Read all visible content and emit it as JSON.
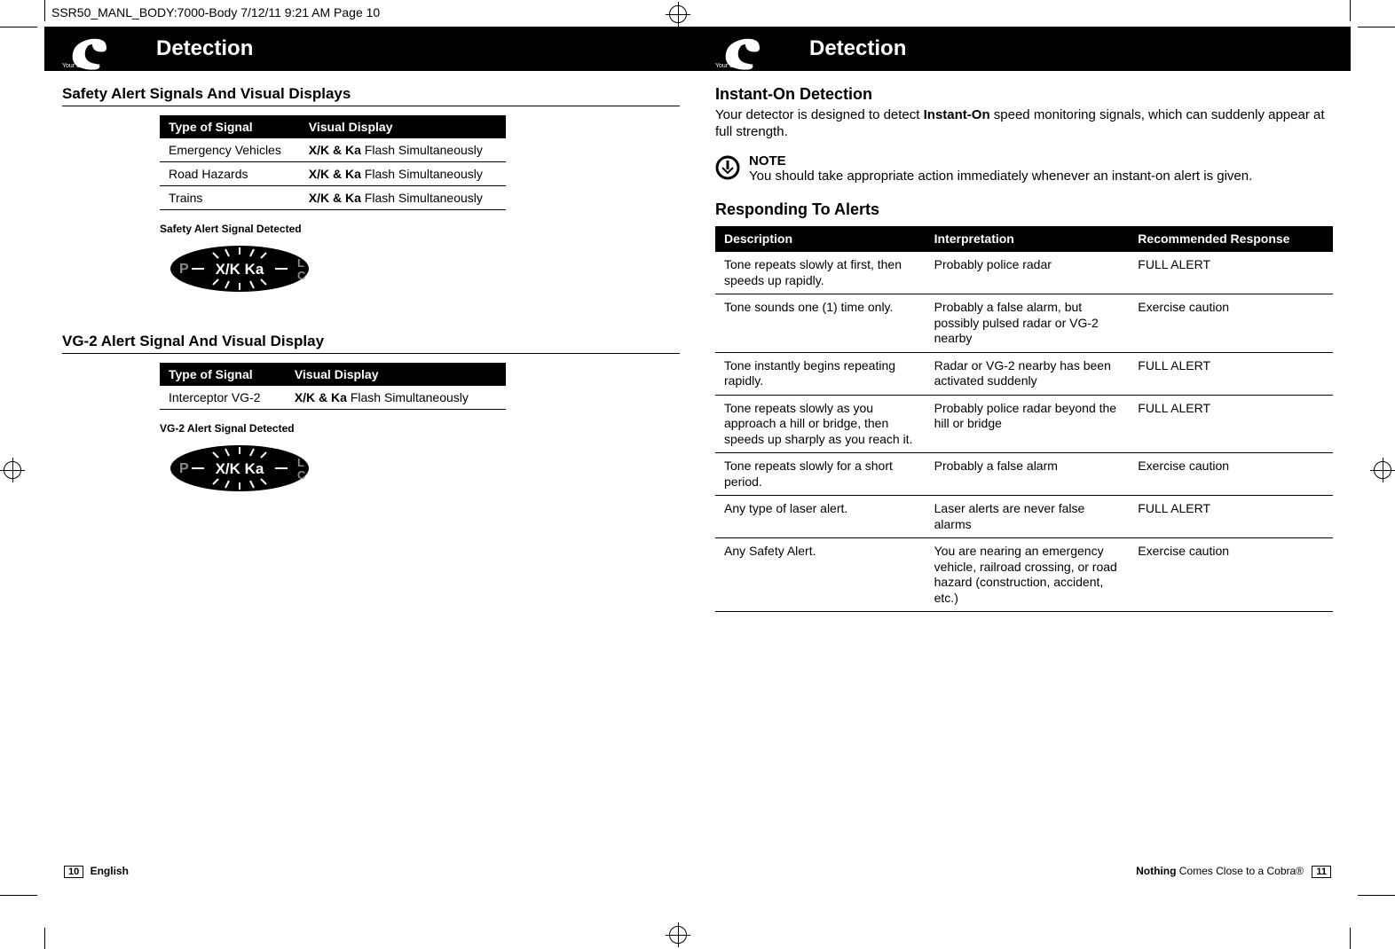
{
  "printmark": "SSR50_MANL_BODY:7000-Body  7/12/11  9:21 AM  Page 10",
  "cobra_tab_label": "Your Detector",
  "band_title": "Detection",
  "left": {
    "section1_title": "Safety Alert Signals And Visual Displays",
    "table1": {
      "head": [
        "Type of Signal",
        "Visual Display"
      ],
      "rows": [
        {
          "type": "Emergency Vehicles",
          "bold": "X/K & Ka",
          "rest": " Flash Simultaneously"
        },
        {
          "type": "Road Hazards",
          "bold": "X/K & Ka",
          "rest": " Flash Simultaneously"
        },
        {
          "type": "Trains",
          "bold": "X/K & Ka",
          "rest": " Flash Simultaneously"
        }
      ]
    },
    "sub_label_1": "Safety Alert Signal Detected",
    "led_left": "P",
    "led_center": "X/K  Ka",
    "led_right_top": "L",
    "led_right_bottom": "C",
    "section2_title": "VG-2 Alert Signal And Visual Display",
    "table2": {
      "head": [
        "Type of Signal",
        "Visual Display"
      ],
      "rows": [
        {
          "type": "Interceptor VG-2",
          "bold": "X/K & Ka",
          "rest": " Flash Simultaneously"
        }
      ]
    },
    "sub_label_2": "VG-2 Alert Signal Detected"
  },
  "right": {
    "h1": "Instant-On Detection",
    "body_pre": "Your detector is designed to detect ",
    "body_bold": "Instant-On",
    "body_post": " speed monitoring signals, which can suddenly appear at full strength.",
    "note_title": "NOTE",
    "note_body": "You should take appropriate action immediately whenever an instant-on alert is given.",
    "h2": "Responding To Alerts",
    "resp_head": [
      "Description",
      "Interpretation",
      "Recommended Response"
    ],
    "resp_rows": [
      {
        "d": "Tone repeats slowly at first, then speeds up rapidly.",
        "i": "Probably police radar",
        "r": "FULL ALERT"
      },
      {
        "d": "Tone sounds one (1) time only.",
        "i": "Probably a false alarm, but possibly pulsed radar or VG-2 nearby",
        "r": "Exercise caution"
      },
      {
        "d": "Tone instantly begins repeating rapidly.",
        "i": "Radar or VG-2 nearby has been activated suddenly",
        "r": "FULL ALERT"
      },
      {
        "d": "Tone repeats slowly as you approach a hill or bridge, then speeds up sharply as you reach it.",
        "i": "Probably police radar beyond the hill or bridge",
        "r": "FULL ALERT"
      },
      {
        "d": "Tone repeats slowly for a short period.",
        "i": "Probably a false alarm",
        "r": "Exercise caution"
      },
      {
        "d": "Any type of laser alert.",
        "i": "Laser alerts are never false alarms",
        "r": "FULL ALERT"
      },
      {
        "d": "Any Safety Alert.",
        "i": "You are nearing an emergency vehicle, railroad crossing, or road hazard (construction, accident, etc.)",
        "r": "Exercise caution"
      }
    ]
  },
  "footer_left_pre": "10",
  "footer_left_text": "English",
  "footer_right_pre": "Nothing",
  "footer_right_text": " Comes Close to a Cobra®",
  "footer_right_num": "11"
}
